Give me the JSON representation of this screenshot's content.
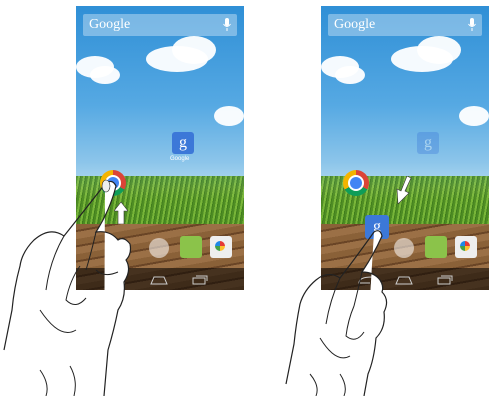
{
  "left_phone": {
    "search_label": "Google",
    "google_app_label": "Google"
  },
  "right_phone": {
    "search_label": "Google"
  },
  "icons": [
    "google-search-app",
    "chrome",
    "app-drawer",
    "messaging",
    "camera",
    "home",
    "back",
    "recent-apps"
  ],
  "colors": {
    "sky": "#56a9e3",
    "grass": "#4e8d24",
    "deck": "#7a5a36",
    "google_blue": "#3c78d8"
  }
}
